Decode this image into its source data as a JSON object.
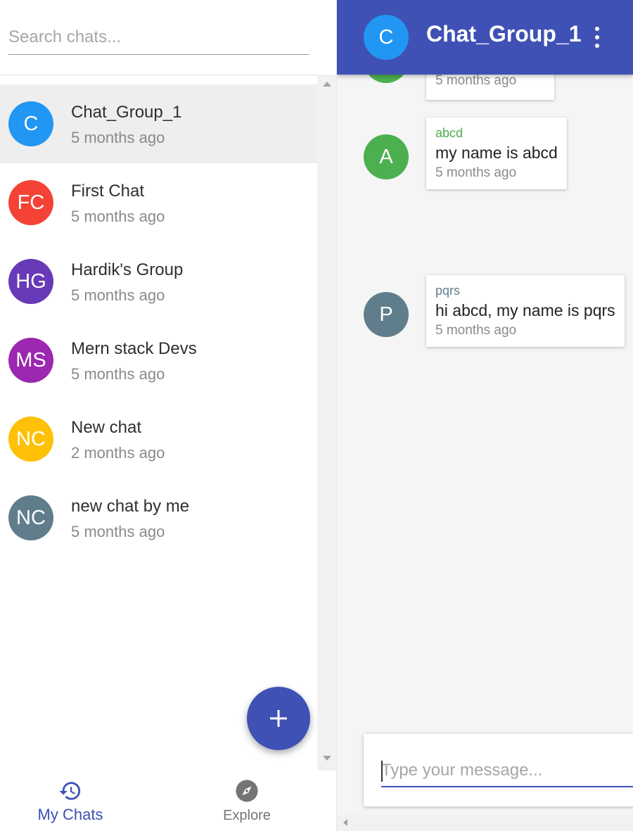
{
  "search": {
    "placeholder": "Search chats..."
  },
  "chats": [
    {
      "initials": "C",
      "name": "Chat_Group_1",
      "time": "5 months ago",
      "color": "#2196f3",
      "selected": true
    },
    {
      "initials": "FC",
      "name": "First Chat",
      "time": "5 months ago",
      "color": "#f44336"
    },
    {
      "initials": "HG",
      "name": "Hardik's Group",
      "time": "5 months ago",
      "color": "#673ab7"
    },
    {
      "initials": "MS",
      "name": "Mern stack Devs",
      "time": "5 months ago",
      "color": "#9c27b0"
    },
    {
      "initials": "NC",
      "name": "New chat",
      "time": "2 months ago",
      "color": "#ffc107"
    },
    {
      "initials": "NC",
      "name": "new chat by me",
      "time": "5 months ago",
      "color": "#607d8b"
    }
  ],
  "fab": {
    "icon": "add-icon"
  },
  "bottom_nav": {
    "my_chats": {
      "label": "My Chats",
      "icon": "history-icon",
      "active": true
    },
    "explore": {
      "label": "Explore",
      "icon": "compass-icon"
    }
  },
  "conversation": {
    "initials": "C",
    "title": "Chat_Group_1",
    "avatar_color": "#2196f3",
    "menu_icon": "more-vert-icon"
  },
  "messages": [
    {
      "time": "5 months ago",
      "avatar_color": "#4caf50",
      "partial": true
    },
    {
      "initials": "A",
      "sender": "abcd",
      "sender_color": "#4caf50",
      "text": "my name is abcd",
      "time": "5 months ago",
      "avatar_color": "#4caf50"
    },
    {
      "initials": "P",
      "sender": "pqrs",
      "sender_color": "#607d8b",
      "text": "hi abcd, my name is pqrs",
      "time": "5 months ago",
      "avatar_color": "#607d8b"
    }
  ],
  "composer": {
    "placeholder": "Type your message..."
  },
  "colors": {
    "primary": "#3f51b5",
    "selected_row": "#eeeeee"
  }
}
